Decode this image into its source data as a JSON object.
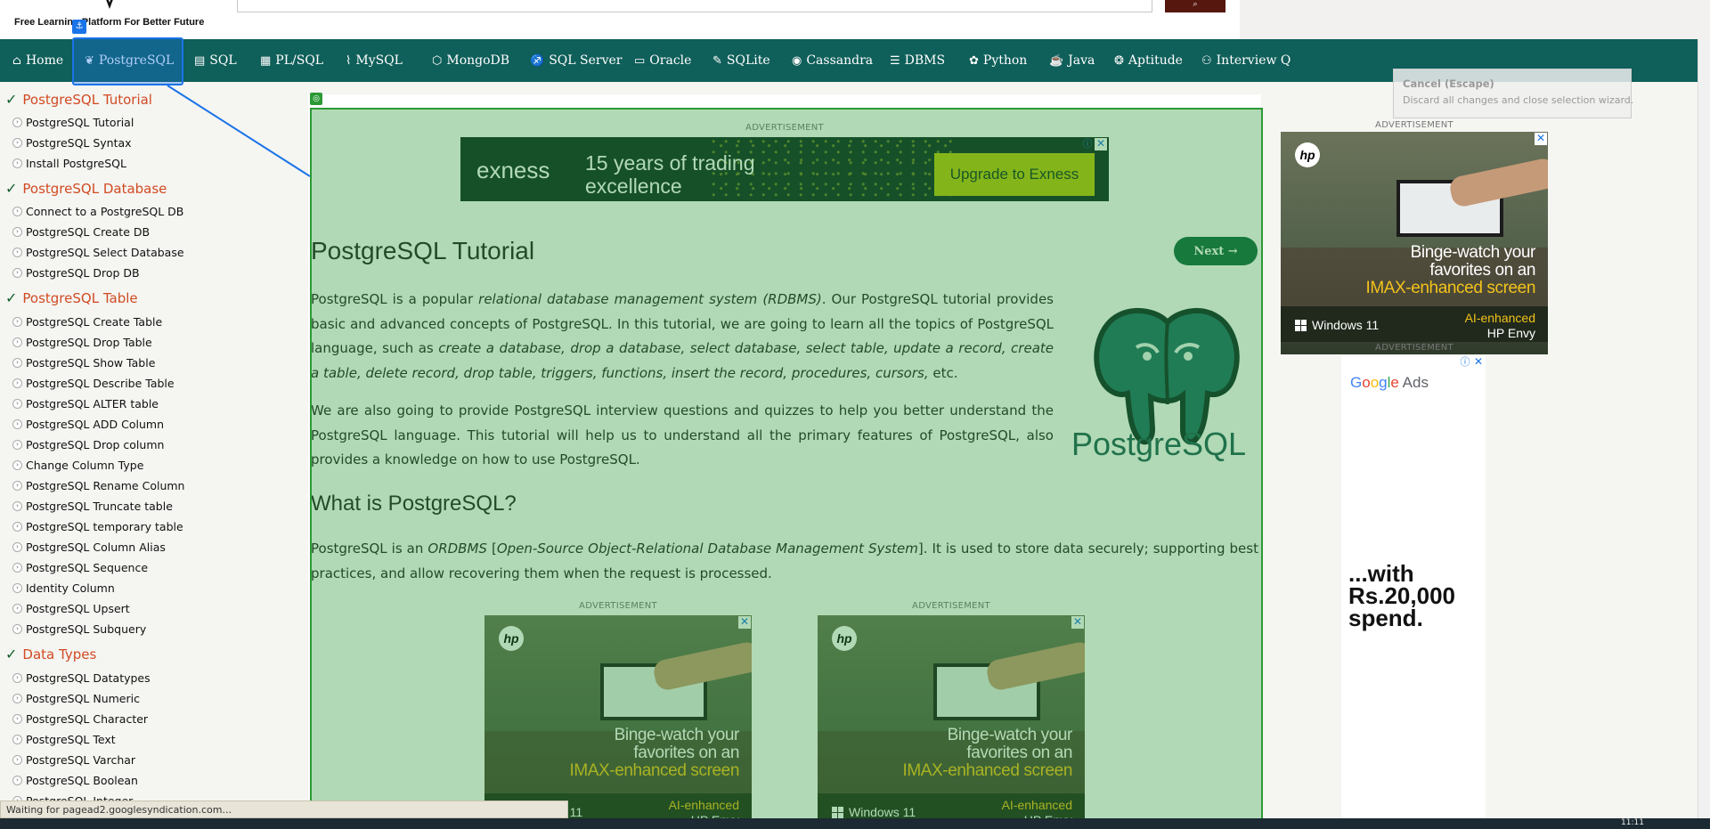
{
  "header": {
    "tagline": "Free Learning Platform For Better Future",
    "search_placeholder": "",
    "search_button_icon": "search-icon"
  },
  "nav": {
    "items": [
      {
        "label": "Home",
        "icon": "home-icon"
      },
      {
        "label": "PostgreSQL",
        "icon": "elephant-icon",
        "active": true
      },
      {
        "label": "SQL",
        "icon": "sql-icon"
      },
      {
        "label": "PL/SQL",
        "icon": "plsql-icon"
      },
      {
        "label": "MySQL",
        "icon": "dolphin-icon"
      },
      {
        "label": "MongoDB",
        "icon": "leaf-icon"
      },
      {
        "label": "SQL Server",
        "icon": "sql-server-icon"
      },
      {
        "label": "Oracle",
        "icon": "oracle-icon"
      },
      {
        "label": "SQLite",
        "icon": "sqlite-icon"
      },
      {
        "label": "Cassandra",
        "icon": "eye-icon"
      },
      {
        "label": "DBMS",
        "icon": "database-icon"
      },
      {
        "label": "Python",
        "icon": "python-icon"
      },
      {
        "label": "Java",
        "icon": "coffee-icon"
      },
      {
        "label": "Aptitude",
        "icon": "brain-icon"
      },
      {
        "label": "Interview Q",
        "icon": "interview-icon"
      }
    ]
  },
  "sidebar": {
    "sections": [
      {
        "heading": "PostgreSQL Tutorial",
        "items": [
          "PostgreSQL Tutorial",
          "PostgreSQL Syntax",
          "Install PostgreSQL"
        ]
      },
      {
        "heading": "PostgreSQL Database",
        "items": [
          "Connect to a PostgreSQL DB",
          "PostgreSQL Create DB",
          "PostgreSQL Select Database",
          "PostgreSQL Drop DB"
        ]
      },
      {
        "heading": "PostgreSQL Table",
        "items": [
          "PostgreSQL Create Table",
          "PostgreSQL Drop Table",
          "PostgreSQL Show Table",
          "PostgreSQL Describe Table",
          "PostgreSQL ALTER table",
          "PostgreSQL ADD Column",
          "PostgreSQL Drop column",
          "Change Column Type",
          "PostgreSQL Rename Column",
          "PostgreSQL Truncate table",
          "PostgreSQL temporary table",
          "PostgreSQL Column Alias",
          "PostgreSQL Sequence",
          "Identity Column",
          "PostgreSQL Upsert",
          "PostgreSQL Subquery"
        ]
      },
      {
        "heading": "Data Types",
        "items": [
          "PostgreSQL Datatypes",
          "PostgreSQL Numeric",
          "PostgreSQL Character",
          "PostgreSQL Text",
          "PostgreSQL Varchar",
          "PostgreSQL Boolean",
          "PostgreSQL Integer"
        ]
      }
    ]
  },
  "ads": {
    "label": "ADVERTISEMENT",
    "exness": {
      "logo": "exness",
      "tagline_1": "15 years of trading",
      "tagline_2": "excellence",
      "cta": "Upgrade to Exness"
    },
    "hp": {
      "logo": "hp",
      "line1": "Binge-watch your",
      "line2": "favorites on an",
      "line3": "IMAX-enhanced screen",
      "os": "Windows 11",
      "model_1": "AI-enhanced",
      "model_2": "HP Envy"
    },
    "google_ads": "Google Ads",
    "promo_1": "...with",
    "promo_2": "Rs.20,000",
    "promo_3": "spend."
  },
  "article": {
    "title": "PostgreSQL Tutorial",
    "next_button": "Next →",
    "para1_a": "PostgreSQL is a popular ",
    "para1_em1": "relational database management system (RDBMS)",
    "para1_b": ". Our PostgreSQL tutorial provides basic and advanced concepts of PostgreSQL. In this tutorial, we are going to learn all the topics of PostgreSQL language, such as ",
    "para1_em2": "create a database, drop a database, select database, select table, update a record, create a table, delete record, drop table, triggers, functions, insert the record, procedures, cursors,",
    "para1_c": " etc.",
    "para2": "We are also going to provide PostgreSQL interview questions and quizzes to help you better understand the PostgreSQL language. This tutorial will help us to understand all the primary features of PostgreSQL, also provides a knowledge on how to use PostgreSQL.",
    "subheading": "What is PostgreSQL?",
    "para3_a": "PostgreSQL is an ",
    "para3_em1": "ORDBMS",
    "para3_b": " [",
    "para3_em2": "Open-Source Object-Relational Database Management System",
    "para3_c": "]. It is used to store data securely; supporting best practices, and allow recovering them when the request is processed.",
    "logo_text": "PostgreSQL"
  },
  "wizard": {
    "cancel_title": "Cancel (Escape)",
    "cancel_desc": "Discard all changes and close selection wizard."
  },
  "status": {
    "text": "Waiting for pagead2.googlesyndication.com...",
    "clock": "11:11"
  },
  "colors": {
    "nav_bg": "#0f5f5a",
    "heading_accent": "#d14b22",
    "selection_green": "#2c9a36",
    "selection_blue": "#1a73e8",
    "next_button": "#0f6a42"
  }
}
